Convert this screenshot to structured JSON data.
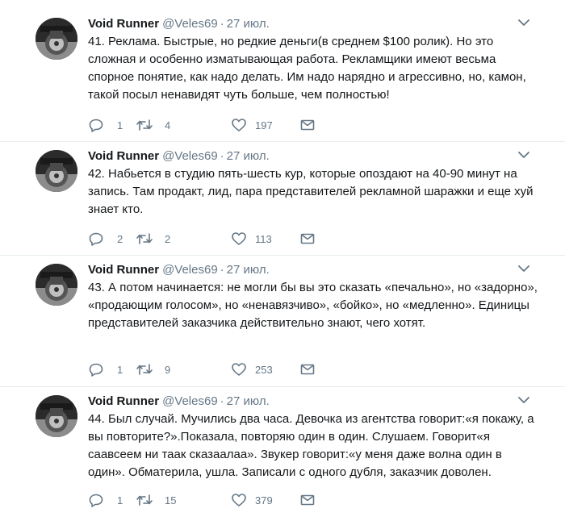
{
  "tweets": [
    {
      "author": "Void Runner",
      "handle": "@Veles69",
      "separator": "·",
      "date": "27 июл.",
      "text": "41. Реклама. Быстрые, но редкие деньги(в среднем $100 ролик). Но это сложная и особенно изматывающая работа. Рекламщики имеют весьма спорное понятие, как надо делать. Им надо нарядно и агрессивно, но, камон, такой посыл ненавидят чуть больше, чем полностью!",
      "replies": "1",
      "retweets": "4",
      "likes": "197"
    },
    {
      "author": "Void Runner",
      "handle": "@Veles69",
      "separator": "·",
      "date": "27 июл.",
      "text": "42. Набьется в студию пять-шесть кур, которые опоздают на 40-90 минут на запись. Там продакт, лид, пара представителей рекламной шаражки и еще хуй знает кто.",
      "replies": "2",
      "retweets": "2",
      "likes": "113"
    },
    {
      "author": "Void Runner",
      "handle": "@Veles69",
      "separator": "·",
      "date": "27 июл.",
      "text": "43. А потом начинается: не могли бы вы это сказать «печально», но «задорно», «продающим голосом», но «ненавязчиво», «бойко», но «медленно». Единицы представителей заказчика действительно знают, чего хотят.",
      "replies": "1",
      "retweets": "9",
      "likes": "253"
    },
    {
      "author": "Void Runner",
      "handle": "@Veles69",
      "separator": "·",
      "date": "27 июл.",
      "text": "44. Был случай. Мучились два часа. Девочка из агентства говорит:«я покажу, а вы повторите?».Показала, повторяю один в один. Слушаем. Говорит«я саавсеем ни таак сказаалаа». Звукер говорит:«у меня даже волна один в один». Обматерила, ушла. Записали с одного дубля, заказчик доволен.",
      "replies": "1",
      "retweets": "15",
      "likes": "379"
    }
  ],
  "colors": {
    "text": "#14171a",
    "secondary": "#657786",
    "divider": "#e6ecf0"
  },
  "icons": [
    "avatar-motorcycle",
    "chevron-down-icon",
    "reply-icon",
    "retweet-icon",
    "like-icon",
    "message-icon"
  ]
}
